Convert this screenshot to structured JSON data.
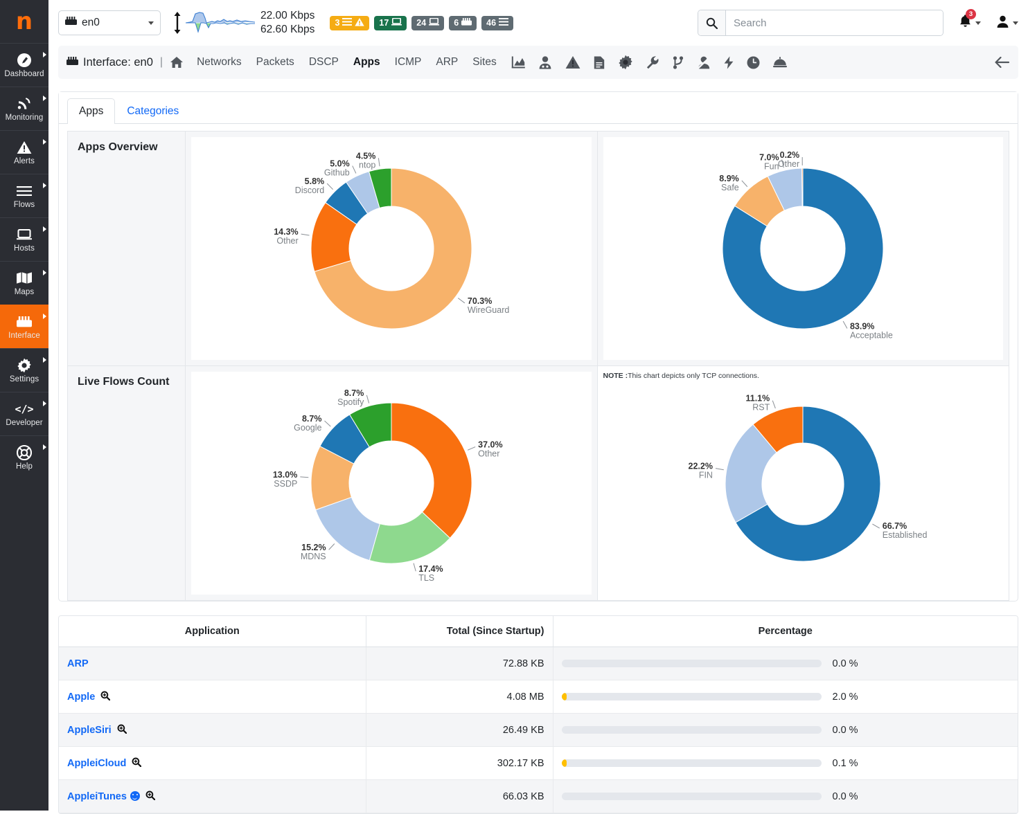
{
  "brand": {
    "logo_text": "n"
  },
  "sidebar": {
    "items": [
      {
        "label": "Dashboard",
        "icon": "dashboard-icon",
        "active": false,
        "caret": true
      },
      {
        "label": "Monitoring",
        "icon": "monitoring-icon",
        "active": false,
        "caret": true
      },
      {
        "label": "Alerts",
        "icon": "alert-triangle-icon",
        "active": false,
        "caret": true
      },
      {
        "label": "Flows",
        "icon": "flows-icon",
        "active": false,
        "caret": true
      },
      {
        "label": "Hosts",
        "icon": "laptop-icon",
        "active": false,
        "caret": true
      },
      {
        "label": "Maps",
        "icon": "map-icon",
        "active": false,
        "caret": true
      },
      {
        "label": "Interface",
        "icon": "interface-icon",
        "active": true,
        "caret": true
      },
      {
        "label": "Settings",
        "icon": "gear-icon",
        "active": false,
        "caret": true
      },
      {
        "label": "Developer",
        "icon": "code-icon",
        "active": false,
        "caret": true
      },
      {
        "label": "Help",
        "icon": "lifebuoy-icon",
        "active": false,
        "caret": true
      }
    ]
  },
  "header": {
    "interface_select": {
      "value": "en0",
      "icon": "interface-icon"
    },
    "rate_down": "22.00 Kbps",
    "rate_up": "62.60 Kbps",
    "badges": [
      {
        "count": "3",
        "icon": "alert-triangle-icon",
        "color": "#f5ac14"
      },
      {
        "count": "17",
        "icon": "laptop-icon",
        "color": "#19734c"
      },
      {
        "count": "24",
        "icon": "laptop-icon",
        "color": "#5f6b72"
      },
      {
        "count": "6",
        "icon": "interface-icon",
        "color": "#5f6b72"
      },
      {
        "count": "46",
        "icon": "menu-icon",
        "color": "#5f6b72"
      }
    ],
    "search": {
      "placeholder": "Search",
      "value": ""
    },
    "notifications": {
      "count": "3"
    }
  },
  "subnav": {
    "title": "Interface: en0",
    "separator": "|",
    "links": [
      {
        "label": "Networks",
        "active": false
      },
      {
        "label": "Packets",
        "active": false
      },
      {
        "label": "DSCP",
        "active": false
      },
      {
        "label": "Apps",
        "active": true
      },
      {
        "label": "ICMP",
        "active": false
      },
      {
        "label": "ARP",
        "active": false
      },
      {
        "label": "Sites",
        "active": false
      }
    ],
    "icons": [
      "home-icon",
      "chart-icon",
      "talker-icon",
      "alert-triangle-icon",
      "report-icon",
      "gear-icon",
      "wrench-icon",
      "git-branch-icon",
      "no-user-icon",
      "bolt-icon",
      "clock-icon",
      "service-icon"
    ],
    "back_icon": "arrow-left-icon"
  },
  "tabs": [
    {
      "label": "Apps",
      "active": true
    },
    {
      "label": "Categories",
      "active": false
    }
  ],
  "panels": {
    "apps_overview_label": "Apps Overview",
    "live_flows_label": "Live Flows Count",
    "tcp_note_prefix": "NOTE :",
    "tcp_note": "This chart depicts only TCP connections."
  },
  "chart_data": [
    {
      "type": "pie",
      "title": "Apps Overview - Applications",
      "donut": true,
      "labels": [
        "WireGuard",
        "Other",
        "Discord",
        "Github",
        "ntop"
      ],
      "values": [
        70.3,
        14.3,
        5.8,
        5.0,
        4.5
      ],
      "display_values": [
        "70.3%",
        "14.3%",
        "5.8%",
        "5.0%",
        "4.5%"
      ],
      "colors": [
        "#f7b26a",
        "#f9700f",
        "#1f77b4",
        "#aec7e8",
        "#2ca02c"
      ],
      "legend": "labels-outside"
    },
    {
      "type": "pie",
      "title": "Apps Overview - Categories",
      "donut": true,
      "labels": [
        "Acceptable",
        "Safe",
        "Fun",
        "Other"
      ],
      "values": [
        83.9,
        8.9,
        7.0,
        0.2
      ],
      "display_values": [
        "83.9%",
        "8.9%",
        "7.0%",
        "0.2%"
      ],
      "colors": [
        "#1f77b4",
        "#f7b26a",
        "#aec7e8",
        "#f9700f"
      ],
      "legend": "labels-outside"
    },
    {
      "type": "pie",
      "title": "Live Flows Count - Applications",
      "donut": true,
      "labels": [
        "Other",
        "TLS",
        "MDNS",
        "SSDP",
        "Google",
        "Spotify"
      ],
      "values": [
        37.0,
        17.4,
        15.2,
        13.0,
        8.7,
        8.7
      ],
      "display_values": [
        "37.0%",
        "17.4%",
        "15.2%",
        "13.0%",
        "8.7%",
        "8.7%"
      ],
      "colors": [
        "#f9700f",
        "#8ed98e",
        "#aec7e8",
        "#f7b26a",
        "#1f77b4",
        "#2ca02c"
      ],
      "legend": "labels-outside"
    },
    {
      "type": "pie",
      "title": "Live Flows Count - TCP states",
      "donut": true,
      "labels": [
        "Established",
        "FIN",
        "RST"
      ],
      "values": [
        66.7,
        22.2,
        11.1
      ],
      "display_values": [
        "66.7%",
        "22.2%",
        "11.1%"
      ],
      "colors": [
        "#1f77b4",
        "#aec7e8",
        "#f9700f"
      ],
      "legend": "labels-outside"
    }
  ],
  "apps_table": {
    "columns": [
      "Application",
      "Total (Since Startup)",
      "Percentage"
    ],
    "rows": [
      {
        "name": "ARP",
        "has_magnifier": false,
        "has_emoji": false,
        "total": "72.88 KB",
        "pct": "0.0 %",
        "pct_value": 0.0
      },
      {
        "name": "Apple",
        "has_magnifier": true,
        "has_emoji": false,
        "total": "4.08 MB",
        "pct": "2.0 %",
        "pct_value": 2.0
      },
      {
        "name": "AppleSiri",
        "has_magnifier": true,
        "has_emoji": false,
        "total": "26.49 KB",
        "pct": "0.0 %",
        "pct_value": 0.0
      },
      {
        "name": "AppleiCloud",
        "has_magnifier": true,
        "has_emoji": false,
        "total": "302.17 KB",
        "pct": "0.1 %",
        "pct_value": 0.1
      },
      {
        "name": "AppleiTunes",
        "has_magnifier": true,
        "has_emoji": true,
        "total": "66.03 KB",
        "pct": "0.0 %",
        "pct_value": 0.0
      }
    ]
  },
  "colors": {
    "accent_orange": "#f5690a",
    "link_blue": "#1269f6",
    "sidebar_bg": "#2b2d33",
    "progress_fill": "#ffbf00"
  }
}
